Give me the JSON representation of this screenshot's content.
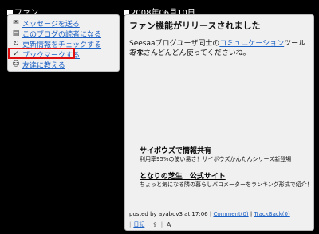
{
  "left_header": "ファン",
  "date_header": "2008年06月10日",
  "fan_menu": [
    {
      "icon": "envelope-icon",
      "label": "メッセージを送る"
    },
    {
      "icon": "book-icon",
      "label": "このブログの読者になる"
    },
    {
      "icon": "refresh-icon",
      "label": "更新情報をチェックする"
    },
    {
      "icon": "checkmark-icon",
      "label": "ブックマークする"
    },
    {
      "icon": "friends-icon",
      "label": "友達に教える"
    }
  ],
  "article": {
    "title": "ファン機能がリリースされました",
    "body_prefix": "Seesaaブログユーザ同士の",
    "body_link": "コミュニケーション",
    "body_suffix": "ツールです。",
    "body_line2": "みなさんどんどん使ってくださいね。",
    "ads": [
      {
        "title": "サイボウズで情報共有",
        "desc": "利用率95%の使い易さ！サイボウズかんたんシリーズ新登場"
      },
      {
        "title": "となりの芝生　公式サイト",
        "desc": "ちょっと気になる隣の暮らしバロメーターをランキング形式で紹介！"
      }
    ],
    "footer": {
      "posted_by": "posted by ayabov3 at 17:06",
      "comment": "Comment(0)",
      "trackback": "TrackBack(0)",
      "sep": "|",
      "icon_label": "日記"
    }
  }
}
